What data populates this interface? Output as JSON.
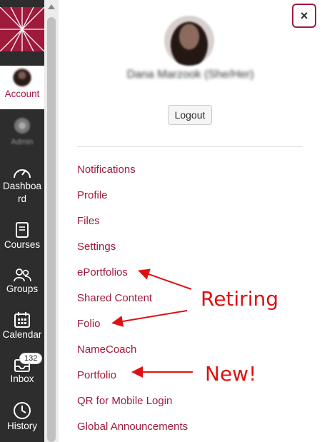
{
  "nav": {
    "account_label": "Account",
    "admin_label": "Admin",
    "dashboard_label": "Dashboard",
    "courses_label": "Courses",
    "groups_label": "Groups",
    "calendar_label": "Calendar",
    "inbox_label": "Inbox",
    "inbox_badge": "132",
    "history_label": "History"
  },
  "tray": {
    "close_label": "×",
    "user_name": "Dana Marzook (She/Her)",
    "logout_label": "Logout",
    "links": [
      "Notifications",
      "Profile",
      "Files",
      "Settings",
      "ePortfolios",
      "Shared Content",
      "Folio",
      "NameCoach",
      "Portfolio",
      "QR for Mobile Login",
      "Global Announcements"
    ]
  },
  "annotations": {
    "retiring": "Retiring",
    "new": "New!"
  },
  "colors": {
    "brand": "#a01a3c",
    "nav_bg": "#2d2d2d",
    "annotation": "#dd1111"
  }
}
